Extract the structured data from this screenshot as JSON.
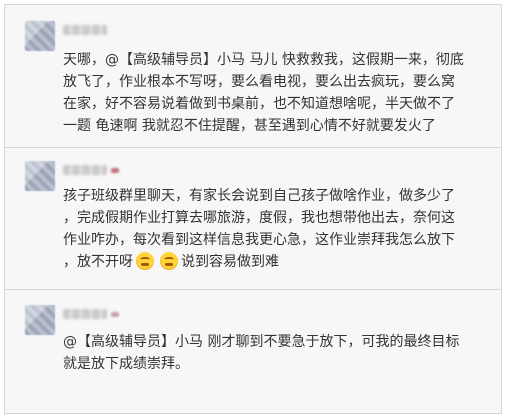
{
  "messages": [
    {
      "lines": [
        "天哪，@【高级辅导员】小马 马儿 快救救我，这假期一来，彻底",
        "放飞了，作业根本不写呀，要么看电视，要么出去疯玩，要么窝",
        "在家，好不容易说着做到书桌前，也不知道想啥呢，半天做不了",
        "一题 龟速啊 我就忍不住提醒，甚至遇到心情不好就要发火了"
      ]
    },
    {
      "lines": [
        "孩子班级群里聊天，有家长会说到自己孩子做啥作业，做多少了",
        "，完成假期作业打算去哪旅游，度假，我也想带他出去，奈何这",
        "作业咋办，每次看到这样信息我更心急，这作业崇拜我怎么放下"
      ],
      "last_line_prefix": "，放不开呀",
      "last_line_suffix": "说到容易做到难",
      "emoji_icons": [
        "grimace-emoji-icon",
        "grimace-emoji-icon"
      ]
    },
    {
      "lines": [
        "@【高级辅导员】小马 刚才聊到不要急于放下，可我的最终目标",
        "就是放下成绩崇拜。"
      ]
    }
  ]
}
